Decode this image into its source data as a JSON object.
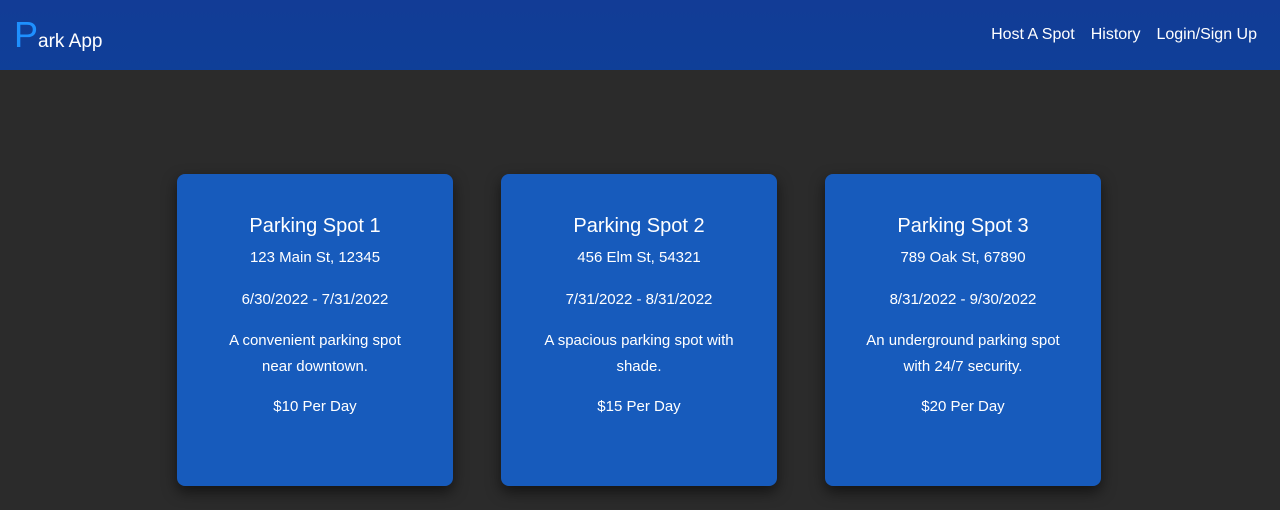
{
  "navbar": {
    "brand_letter": "P",
    "brand_rest": "ark App",
    "links": [
      "Host A Spot",
      "History",
      "Login/Sign Up"
    ]
  },
  "colors": {
    "navbar": "#123c96",
    "brand_accent": "#1e90ff",
    "background": "#2b2b2b",
    "card": "#175bbc"
  },
  "cards": [
    {
      "title": "Parking Spot 1",
      "address": "123 Main St, 12345",
      "dates": "6/30/2022 - 7/31/2022",
      "description": "A convenient parking spot near downtown.",
      "price": "$10 Per Day"
    },
    {
      "title": "Parking Spot 2",
      "address": "456 Elm St, 54321",
      "dates": "7/31/2022 - 8/31/2022",
      "description": "A spacious parking spot with shade.",
      "price": "$15 Per Day"
    },
    {
      "title": "Parking Spot 3",
      "address": "789 Oak St, 67890",
      "dates": "8/31/2022 - 9/30/2022",
      "description": "An underground parking spot with 24/7 security.",
      "price": "$20 Per Day"
    }
  ]
}
